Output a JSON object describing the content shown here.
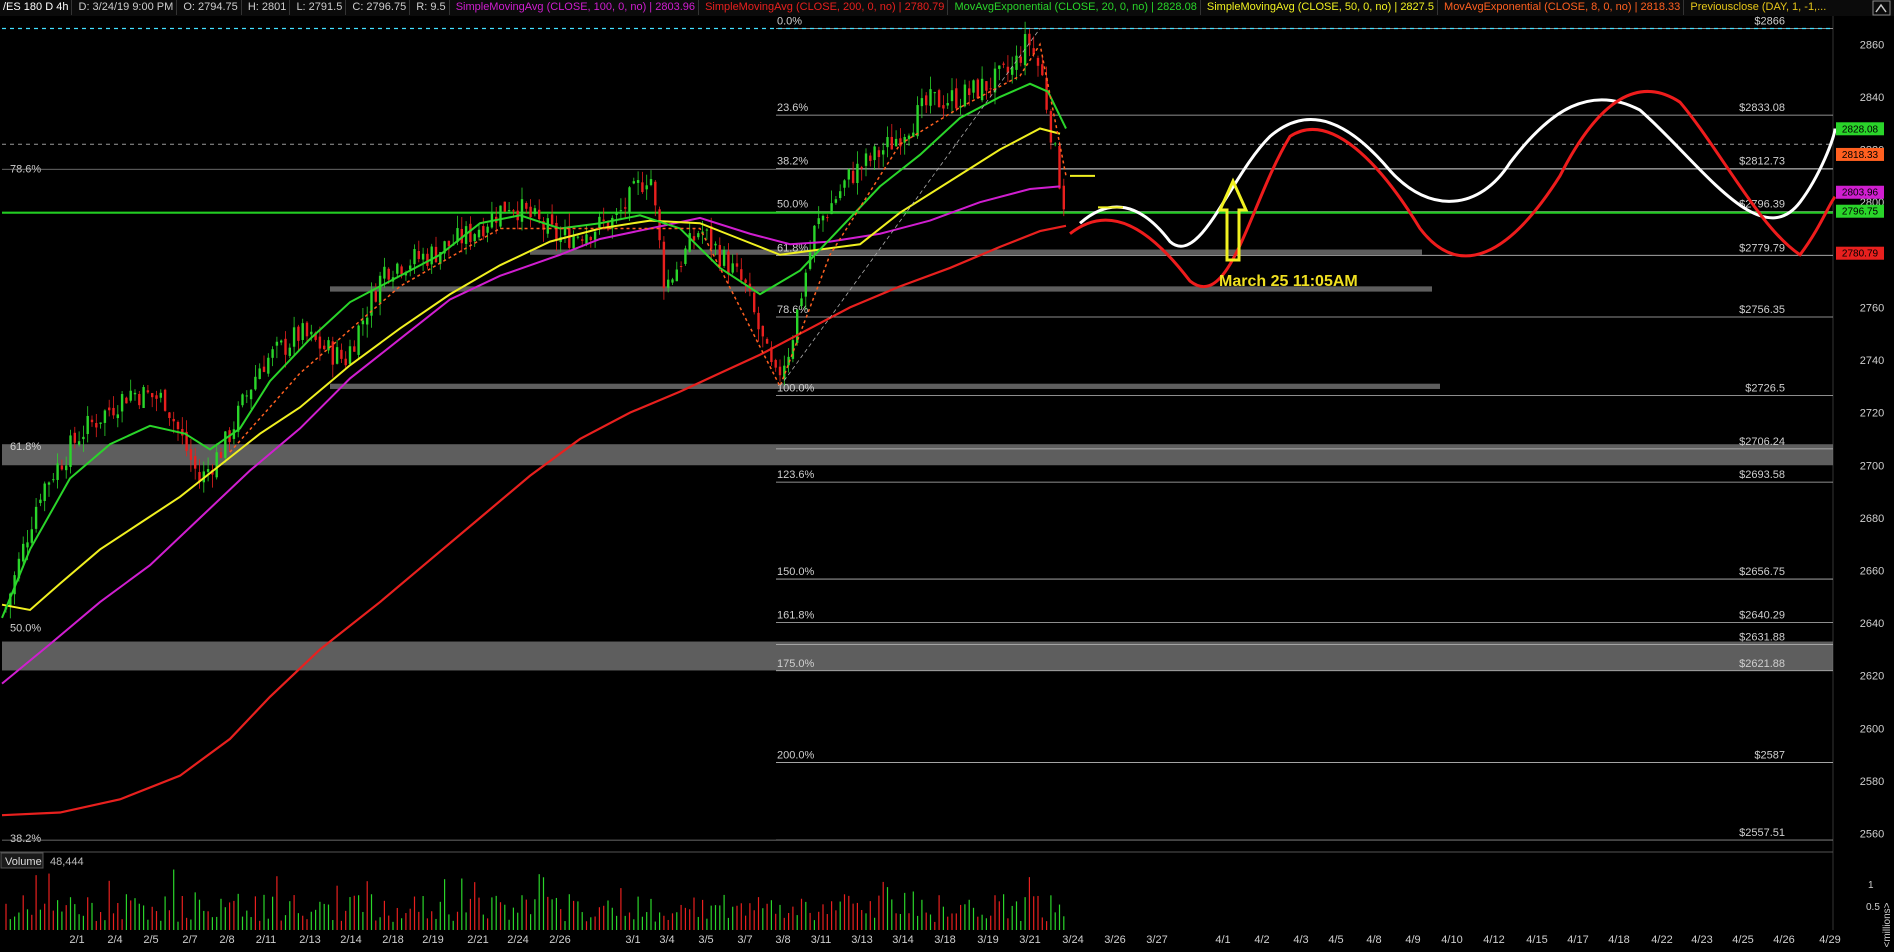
{
  "header": {
    "symbol": "/ES 180 D 4h",
    "date": "D: 3/24/19 9:00 PM",
    "open": "O: 2794.75",
    "high": "H: 2801",
    "low": "L: 2791.5",
    "close": "C: 2796.75",
    "range": "R: 9.5",
    "studies": [
      {
        "label": "SimpleMovingAvg (CLOSE, 100, 0, no)",
        "value": "2803.96",
        "color": "#d01ed0"
      },
      {
        "label": "SimpleMovingAvg (CLOSE, 200, 0, no)",
        "value": "2780.79",
        "color": "#e8201e"
      },
      {
        "label": "MovAvgExponential (CLOSE, 20, 0, no)",
        "value": "2828.08",
        "color": "#2ad52a"
      },
      {
        "label": "SimpleMovingAvg (CLOSE, 50, 0, no)",
        "value": "2827.5",
        "color": "#f0f020"
      },
      {
        "label": "MovAvgExponential (CLOSE, 8, 0, no)",
        "value": "2818.33",
        "color": "#ff6020"
      },
      {
        "label": "Previousclose (DAY, 1, -1,...",
        "value": "",
        "color": "#e6c619"
      }
    ]
  },
  "volume_label": "Volume",
  "volume_value": "48,444",
  "volume_unit": "<millions>",
  "annotation": "March 25 11:05AM",
  "chart_data": {
    "type": "candlestick",
    "title": "/ES 180 D 4h",
    "y_ticks": [
      2560,
      2580,
      2600,
      2620,
      2640,
      2660,
      2680,
      2700,
      2720,
      2740,
      2760,
      2780,
      2800,
      2820,
      2840,
      2860
    ],
    "y_range": [
      2553,
      2870
    ],
    "x_ticks": [
      "2/1",
      "2/4",
      "2/5",
      "2/7",
      "2/8",
      "2/11",
      "2/13",
      "2/14",
      "2/18",
      "2/19",
      "2/21",
      "2/24",
      "2/26",
      "3/1",
      "3/4",
      "3/5",
      "3/7",
      "3/8",
      "3/11",
      "3/13",
      "3/14",
      "3/18",
      "3/19",
      "3/21",
      "3/24",
      "3/26",
      "3/27",
      "4/1",
      "4/2",
      "4/3",
      "4/5",
      "4/8",
      "4/9",
      "4/10",
      "4/12",
      "4/15",
      "4/17",
      "4/18",
      "4/22",
      "4/23",
      "4/25",
      "4/26",
      "4/29"
    ],
    "price_levels": [
      {
        "label": "$2866",
        "value": 2866
      },
      {
        "label": "$2833.08",
        "value": 2833.08
      },
      {
        "label": "$2812.73",
        "value": 2812.73
      },
      {
        "label": "$2796.39",
        "value": 2796.39
      },
      {
        "label": "$2779.79",
        "value": 2779.79
      },
      {
        "label": "$2756.35",
        "value": 2756.35
      },
      {
        "label": "$2726.5",
        "value": 2726.5
      },
      {
        "label": "$2706.24",
        "value": 2706.24
      },
      {
        "label": "$2693.58",
        "value": 2693.58
      },
      {
        "label": "$2656.75",
        "value": 2656.75
      },
      {
        "label": "$2640.29",
        "value": 2640.29
      },
      {
        "label": "$2631.88",
        "value": 2631.88
      },
      {
        "label": "$2621.88",
        "value": 2621.88
      },
      {
        "label": "$2587",
        "value": 2587
      },
      {
        "label": "$2557.51",
        "value": 2557.51
      }
    ],
    "fib_labels_right": [
      {
        "label": "0.0%",
        "value": 2866
      },
      {
        "label": "23.6%",
        "value": 2833.08
      },
      {
        "label": "38.2%",
        "value": 2812.73
      },
      {
        "label": "50.0%",
        "value": 2796.39
      },
      {
        "label": "61.8%",
        "value": 2779.79
      },
      {
        "label": "78.6%",
        "value": 2756.35
      },
      {
        "label": "100.0%",
        "value": 2726.5
      },
      {
        "label": "123.6%",
        "value": 2693.58
      },
      {
        "label": "150.0%",
        "value": 2656.75
      },
      {
        "label": "161.8%",
        "value": 2640.29
      },
      {
        "label": "175.0%",
        "value": 2621.88
      },
      {
        "label": "200.0%",
        "value": 2587
      }
    ],
    "fib_labels_left": [
      {
        "label": "78.6%",
        "value": 2812.5
      },
      {
        "label": "61.8%",
        "value": 2707
      },
      {
        "label": "50.0%",
        "value": 2638
      },
      {
        "label": "38.2%",
        "value": 2558
      }
    ],
    "axis_tags": [
      {
        "label": "2828.08",
        "value": 2828.08,
        "color": "#2ad52a"
      },
      {
        "label": "2818.33",
        "value": 2818.33,
        "color": "#ff6020"
      },
      {
        "label": "2803.96",
        "value": 2803.96,
        "color": "#d01ed0"
      },
      {
        "label": "2796.75",
        "value": 2796.75,
        "color": "#2ad52a"
      },
      {
        "label": "2780.79",
        "value": 2780.79,
        "color": "#e8201e"
      }
    ],
    "volume_ticks": [
      "1",
      "0.5"
    ],
    "colors": {
      "up": "#2ad52a",
      "down": "#e8201e",
      "projection_white": "#ffffff",
      "projection_red": "#ee1c1c",
      "zone": "#7d7d7d"
    }
  }
}
